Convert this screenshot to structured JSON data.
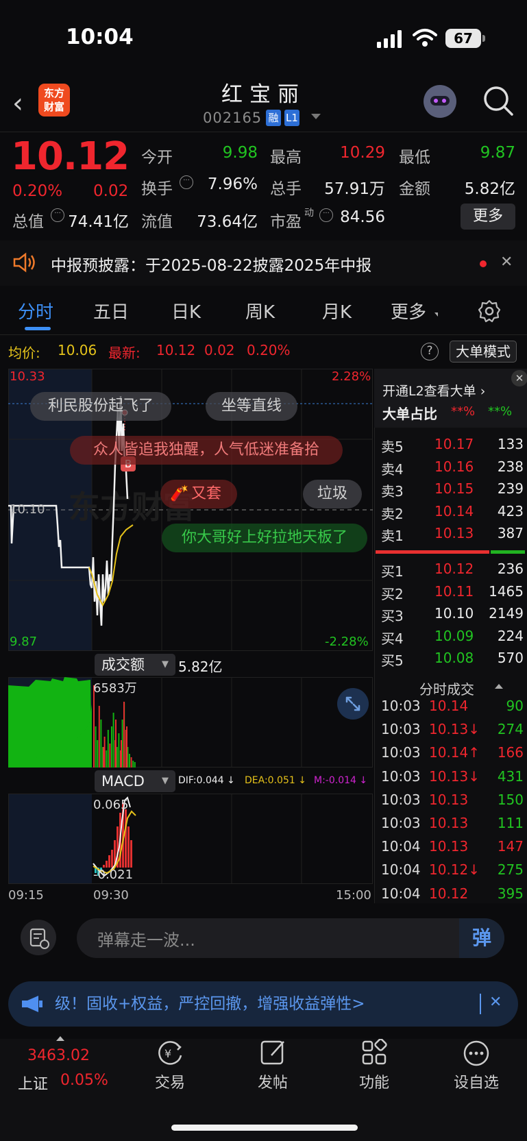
{
  "status": {
    "time": "10:04",
    "battery": "67"
  },
  "header": {
    "logo_line1": "东方",
    "logo_line2": "财富",
    "name": "红宝丽",
    "code": "002165",
    "tag_margin": "融",
    "tag_level": "L1"
  },
  "quote": {
    "price": "10.12",
    "change_pct": "0.20%",
    "change": "0.02",
    "open_label": "今开",
    "open": "9.98",
    "high_label": "最高",
    "high": "10.29",
    "low_label": "最低",
    "low": "9.87",
    "turnover_label": "换手",
    "turnover": "7.96%",
    "volume_label": "总手",
    "volume": "57.91万",
    "amount_label": "金额",
    "amount": "5.82亿",
    "mcap_label": "总值",
    "mcap": "74.41亿",
    "float_label": "流值",
    "float": "73.64亿",
    "pe_label": "市盈",
    "pe_sup": "动",
    "pe": "84.56",
    "more_label": "更多"
  },
  "notice": {
    "text": "中报预披露：于2025-08-22披露2025年中报"
  },
  "tabs": [
    "分时",
    "五日",
    "日K",
    "周K",
    "月K",
    "更多"
  ],
  "infobar": {
    "avg_label": "均价:",
    "avg": "10.06",
    "latest_label": "最新:",
    "latest": "10.12",
    "latest_chg": "0.02",
    "latest_pct": "0.20%",
    "bigmode": "大单模式"
  },
  "price_axis": {
    "top": "10.33",
    "mid": "10.10",
    "bottom": "9.87",
    "top_pct": "2.28%",
    "bottom_pct": "-2.28%"
  },
  "danmu": [
    "利民股份起飞了",
    "坐等直线",
    "众人皆追我独醒，人气低迷准备拾",
    "又套",
    "垃圾",
    "你大哥好上好拉地天板了"
  ],
  "marker": "B",
  "volume_panel": {
    "label": "成交额",
    "value": "5.82亿",
    "max": "6583万"
  },
  "macd_panel": {
    "label": "MACD",
    "dif": "DIF:0.044 ↓",
    "dea": "DEA:0.051 ↓",
    "m": "M:-0.014 ↓",
    "top": "0.065",
    "bottom": "-0.021"
  },
  "time_axis": [
    "09:15",
    "09:30",
    "15:00"
  ],
  "l2": {
    "title": "开通L2查看大单 ›",
    "ratio_label": "大单占比",
    "ratio_red": "**%",
    "ratio_green": "**%"
  },
  "asks": [
    {
      "label": "卖5",
      "price": "10.17",
      "vol": "133",
      "color": "red"
    },
    {
      "label": "卖4",
      "price": "10.16",
      "vol": "238",
      "color": "red"
    },
    {
      "label": "卖3",
      "price": "10.15",
      "vol": "239",
      "color": "red"
    },
    {
      "label": "卖2",
      "price": "10.14",
      "vol": "423",
      "color": "red"
    },
    {
      "label": "卖1",
      "price": "10.13",
      "vol": "387",
      "color": "red"
    }
  ],
  "bids": [
    {
      "label": "买1",
      "price": "10.12",
      "vol": "236",
      "color": "red"
    },
    {
      "label": "买2",
      "price": "10.11",
      "vol": "1465",
      "color": "red"
    },
    {
      "label": "买3",
      "price": "10.10",
      "vol": "2149",
      "color": "white"
    },
    {
      "label": "买4",
      "price": "10.09",
      "vol": "224",
      "color": "green"
    },
    {
      "label": "买5",
      "price": "10.08",
      "vol": "570",
      "color": "green"
    }
  ],
  "ticks_title": "分时成交",
  "ticks": [
    {
      "time": "10:03",
      "price": "10.14",
      "vol": "90",
      "dir": "",
      "vcolor": "green"
    },
    {
      "time": "10:03",
      "price": "10.13↓",
      "vol": "274",
      "dir": "down",
      "vcolor": "green"
    },
    {
      "time": "10:03",
      "price": "10.14↑",
      "vol": "166",
      "dir": "up",
      "vcolor": "red"
    },
    {
      "time": "10:03",
      "price": "10.13↓",
      "vol": "431",
      "dir": "down",
      "vcolor": "green"
    },
    {
      "time": "10:03",
      "price": "10.13",
      "vol": "150",
      "dir": "",
      "vcolor": "green"
    },
    {
      "time": "10:03",
      "price": "10.13",
      "vol": "111",
      "dir": "",
      "vcolor": "green"
    },
    {
      "time": "10:04",
      "price": "10.13",
      "vol": "147",
      "dir": "",
      "vcolor": "red"
    },
    {
      "time": "10:04",
      "price": "10.12↓",
      "vol": "275",
      "dir": "down",
      "vcolor": "green"
    },
    {
      "time": "10:04",
      "price": "10.12",
      "vol": "395",
      "dir": "",
      "vcolor": "green"
    }
  ],
  "chat": {
    "placeholder": "弹幕走一波...",
    "send": "弹"
  },
  "ad": {
    "text": "级！固收+权益，严控回撤，增强收益弹性>"
  },
  "index": {
    "value": "3463.02",
    "name": "上证",
    "pct": "0.05%"
  },
  "nav": [
    "交易",
    "发帖",
    "功能",
    "设自选"
  ]
}
